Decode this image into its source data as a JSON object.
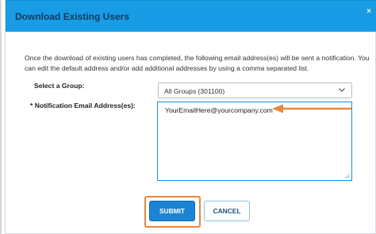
{
  "dialog": {
    "title": "Download Existing Users",
    "close_glyph": "×",
    "notice": "Once the download of existing users has completed, the following email address(es) will be sent a notification. You can edit the default address and/or add additional addresses by using a comma separated list."
  },
  "form": {
    "group_label": "Select a Group:",
    "group_selected": "All Groups (301100)",
    "email_label": "* Notification Email Address(es):",
    "email_value": "YourEmailHere@yourcompany.com"
  },
  "buttons": {
    "submit": "SUBMIT",
    "cancel": "CANCEL"
  },
  "colors": {
    "titlebar": "#189ce6",
    "submit": "#1b84d2",
    "highlight": "#e8863f"
  },
  "icons": {
    "close": "close-icon",
    "dropdown": "chevron-down-icon",
    "annotation": "arrow-left-icon"
  }
}
